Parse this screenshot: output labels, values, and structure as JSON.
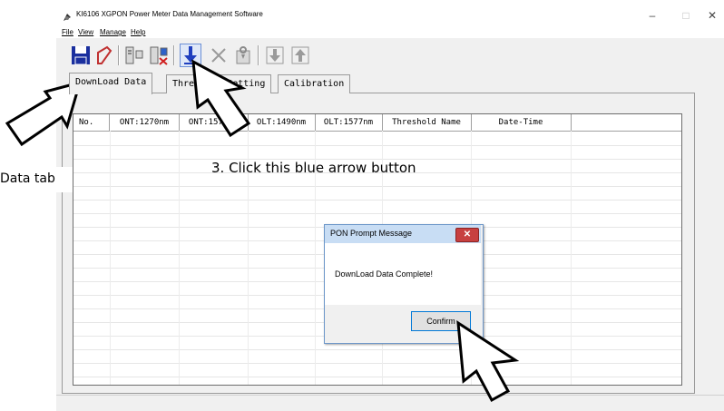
{
  "window": {
    "title": "KI6106 XGPON Power Meter Data Management Software",
    "controls": {
      "minimize": "–",
      "maximize": "□",
      "close": "✕"
    }
  },
  "menu": [
    "File",
    "View",
    "Manage",
    "Help"
  ],
  "toolbar": {
    "icons": [
      "save-icon",
      "clear-icon",
      "meter-icon",
      "meter-delete-icon",
      "download-arrow-icon",
      "delete-x-icon",
      "upload-file-icon",
      "down-arrow-icon",
      "up-arrow-icon"
    ]
  },
  "tabs": [
    {
      "label": "DownLoad Data"
    },
    {
      "label": "Threshold Setting"
    },
    {
      "label": "Calibration"
    }
  ],
  "grid": {
    "columns": [
      "No.",
      "ONT:1270nm",
      "ONT:1577nm",
      "OLT:1490nm",
      "OLT:1577nm",
      "Threshold Name",
      "Date-Time"
    ]
  },
  "dialog": {
    "title": "PON Prompt Message",
    "message": "DownLoad Data Complete!",
    "confirm_label": "Confirm",
    "close_label": "✕"
  },
  "annotations": {
    "tab_hint": "Data tab",
    "step3": "3. Click this blue arrow button"
  },
  "colors": {
    "accent_blue": "#1f3fbf",
    "dialog_close": "#c74040",
    "dialog_title_bg": "#c8ddf4"
  }
}
